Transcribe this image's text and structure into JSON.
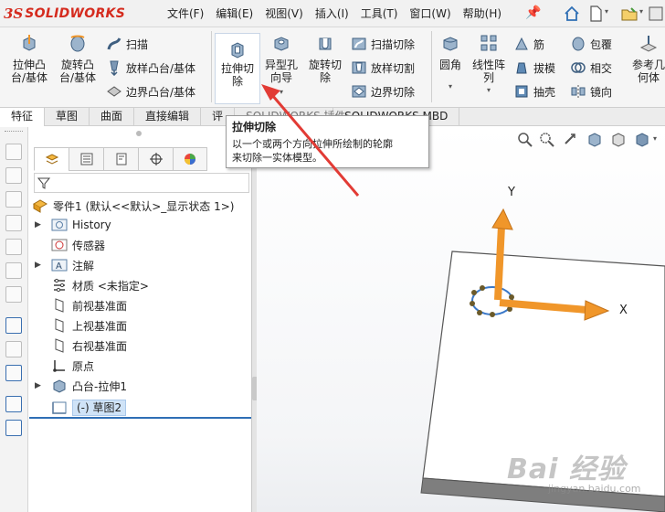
{
  "app": {
    "logo_ds": "3S",
    "logo_text": "SOLIDWORKS"
  },
  "menu": [
    "文件(F)",
    "编辑(E)",
    "视图(V)",
    "插入(I)",
    "工具(T)",
    "窗口(W)",
    "帮助(H)"
  ],
  "ribbon": {
    "extrude_boss": "拉伸凸\n台/基体",
    "revolve_boss": "旋转凸\n台/基体",
    "sweep": "扫描",
    "loft_boss": "放样凸台/基体",
    "boundary_boss": "边界凸台/基体",
    "extrude_cut": "拉伸切\n除",
    "hole_wizard": "异型孔\n向导",
    "revolve_cut": "旋转切\n除",
    "sweep_cut": "扫描切除",
    "loft_cut": "放样切割",
    "boundary_cut": "边界切除",
    "fillet": "圆角",
    "linear_pattern": "线性阵\n列",
    "rib": "筋",
    "draft": "拔模",
    "shell": "抽壳",
    "wrap": "包覆",
    "intersect": "相交",
    "mirror": "镜向",
    "reference_geometry": "参考几\n何体"
  },
  "ribbon_tabs": [
    "特征",
    "草图",
    "曲面",
    "直接编辑",
    "评",
    "SOLIDWORKS 插件",
    "SOLIDWORKS MBD"
  ],
  "tooltip": {
    "title": "拉伸切除",
    "body_line1": "以一个或两个方向拉伸所绘制的轮廓",
    "body_line2": "来切除一实体模型。"
  },
  "tree": {
    "root": "零件1 (默认<<默认>_显示状态 1>)",
    "items": [
      "History",
      "传感器",
      "注解",
      "材质 <未指定>",
      "前视基准面",
      "上视基准面",
      "右视基准面",
      "原点",
      "凸台-拉伸1",
      "(-) 草图2"
    ]
  },
  "axes": {
    "x": "X",
    "y": "Y"
  },
  "colors": {
    "accent": "#2f6fb5",
    "arrow": "#f0962a",
    "logo": "#d52b1e"
  },
  "watermark": {
    "brand": "Bai 经验",
    "url": "jingyan.baidu.com"
  }
}
